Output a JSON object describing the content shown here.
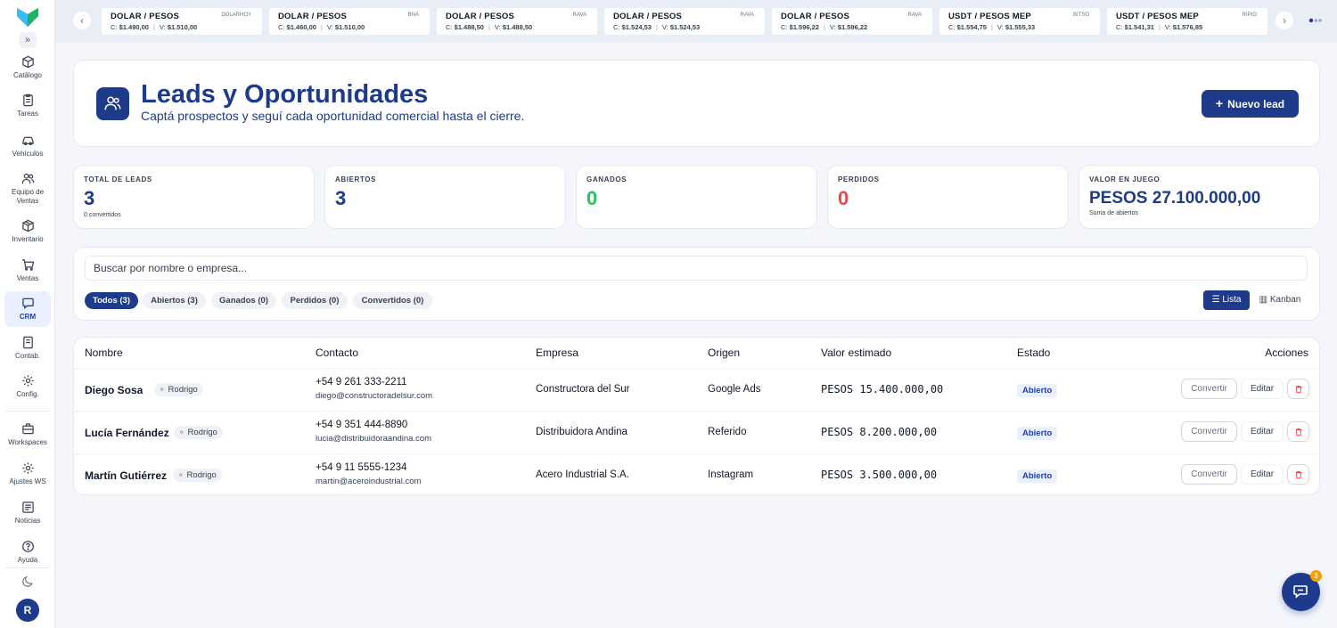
{
  "app": {
    "user_initial": "R",
    "chat_badge": "3"
  },
  "sidebar": {
    "items": [
      {
        "label": "Catálogo",
        "icon": "catalog-icon"
      },
      {
        "label": "Tareas",
        "icon": "tasks-icon"
      },
      {
        "label": "Vehículos",
        "icon": "car-icon"
      },
      {
        "label": "Equipo de Ventas",
        "icon": "team-icon"
      },
      {
        "label": "Inventario",
        "icon": "box-icon"
      },
      {
        "label": "Ventas",
        "icon": "cart-icon"
      },
      {
        "label": "CRM",
        "icon": "crm-icon",
        "active": true
      },
      {
        "label": "Contab.",
        "icon": "ledger-icon"
      },
      {
        "label": "Config.",
        "icon": "gear-icon"
      },
      {
        "label": "Workspaces",
        "icon": "workspaces-icon"
      },
      {
        "label": "Ajustes WS",
        "icon": "settings-icon"
      },
      {
        "label": "Noticias",
        "icon": "news-icon"
      },
      {
        "label": "Ayuda",
        "icon": "help-icon"
      }
    ]
  },
  "rates": [
    {
      "pair": "DOLAR / PESOS",
      "source": "DOLARHOY",
      "buy_label": "C:",
      "buy": "$1.490,00",
      "sell_label": "V:",
      "sell": "$1.510,00"
    },
    {
      "pair": "DOLAR / PESOS",
      "source": "BNA",
      "buy_label": "C:",
      "buy": "$1.460,00",
      "sell_label": "V:",
      "sell": "$1.510,00"
    },
    {
      "pair": "DOLAR / PESOS",
      "source": "RAVA",
      "buy_label": "C:",
      "buy": "$1.488,50",
      "sell_label": "V:",
      "sell": "$1.488,50"
    },
    {
      "pair": "DOLAR / PESOS",
      "source": "RAVA",
      "buy_label": "C:",
      "buy": "$1.524,53",
      "sell_label": "V:",
      "sell": "$1.524,53"
    },
    {
      "pair": "DOLAR / PESOS",
      "source": "RAVA",
      "buy_label": "C:",
      "buy": "$1.596,22",
      "sell_label": "V:",
      "sell": "$1.596,22"
    },
    {
      "pair": "USDT / PESOS MEP",
      "source": "BITSO",
      "buy_label": "C:",
      "buy": "$1.554,75",
      "sell_label": "V:",
      "sell": "$1.555,33"
    },
    {
      "pair": "USDT / PESOS MEP",
      "source": "RIPIO",
      "buy_label": "C:",
      "buy": "$1.541,31",
      "sell_label": "V:",
      "sell": "$1.576,85"
    }
  ],
  "header": {
    "title": "Leads y Oportunidades",
    "subtitle": "Captá prospectos y seguí cada oportunidad comercial hasta el cierre.",
    "new_lead_label": "Nuevo lead"
  },
  "stats": [
    {
      "label": "Total de leads",
      "value": "3",
      "note": "0 convertidos",
      "color": "#1e3a8a"
    },
    {
      "label": "Abiertos",
      "value": "3",
      "note": "",
      "color": "#1e3a8a"
    },
    {
      "label": "Ganados",
      "value": "0",
      "note": "",
      "color": "#22c55e"
    },
    {
      "label": "Perdidos",
      "value": "0",
      "note": "",
      "color": "#ef4444"
    },
    {
      "label": "Valor en juego",
      "value": "PESOS 27.100.000,00",
      "note": "Suma de abiertos",
      "color": "#1e3a8a"
    }
  ],
  "search": {
    "placeholder": "Buscar por nombre o empresa..."
  },
  "filters": [
    {
      "label": "Todos (3)",
      "active": true
    },
    {
      "label": "Abiertos (3)"
    },
    {
      "label": "Ganados (0)"
    },
    {
      "label": "Perdidos (0)"
    },
    {
      "label": "Convertidos (0)"
    }
  ],
  "views": {
    "list_label": "Lista",
    "kanban_label": "Kanban"
  },
  "table": {
    "columns": [
      "Nombre",
      "Contacto",
      "Empresa",
      "Origen",
      "Valor estimado",
      "Estado",
      "Acciones"
    ],
    "rows": [
      {
        "name": "Diego Sosa",
        "owner": "Rodrigo",
        "phone": "+54 9 261 333-2211",
        "email": "diego@constructoradelsur.com",
        "company": "Constructora del Sur",
        "source": "Google Ads",
        "value": "PESOS 15.400.000,00",
        "status": "Abierto"
      },
      {
        "name": "Lucía Fernández",
        "owner": "Rodrigo",
        "phone": "+54 9 351 444-8890",
        "email": "lucia@distribuidoraandina.com",
        "company": "Distribuidora Andina",
        "source": "Referido",
        "value": "PESOS 8.200.000,00",
        "status": "Abierto"
      },
      {
        "name": "Martín Gutiérrez",
        "owner": "Rodrigo",
        "phone": "+54 9 11 5555-1234",
        "email": "martin@aceroindustrial.com",
        "company": "Acero Industrial S.A.",
        "source": "Instagram",
        "value": "PESOS 3.500.000,00",
        "status": "Abierto"
      }
    ],
    "actions": {
      "convert_label": "Convertir",
      "edit_label": "Editar"
    }
  }
}
